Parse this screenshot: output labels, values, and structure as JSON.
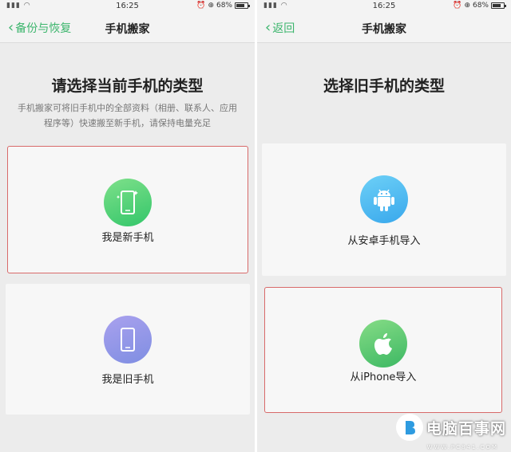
{
  "left_screen": {
    "status": {
      "time": "16:25",
      "battery": "68%"
    },
    "nav": {
      "back_label": "备份与恢复",
      "title": "手机搬家"
    },
    "heading": "请选择当前手机的类型",
    "description": "手机搬家可将旧手机中的全部资料（相册、联系人、应用程序等）快速搬至新手机，请保持电量充足",
    "cards": [
      {
        "label": "我是新手机",
        "icon": "new-phone-icon",
        "color": "#33c66a"
      },
      {
        "label": "我是旧手机",
        "icon": "old-phone-icon",
        "color": "#8a8fe4"
      }
    ]
  },
  "right_screen": {
    "status": {
      "time": "16:25",
      "battery": "68%"
    },
    "nav": {
      "back_label": "返回",
      "title": "手机搬家"
    },
    "heading": "选择旧手机的类型",
    "cards": [
      {
        "label": "从安卓手机导入",
        "icon": "android-icon",
        "color": "#39a8ec"
      },
      {
        "label": "从iPhone导入",
        "icon": "apple-icon",
        "color": "#3cb863"
      }
    ]
  },
  "watermark": {
    "text": "电脑百事网",
    "sub": "WWW.PC841.COM"
  }
}
